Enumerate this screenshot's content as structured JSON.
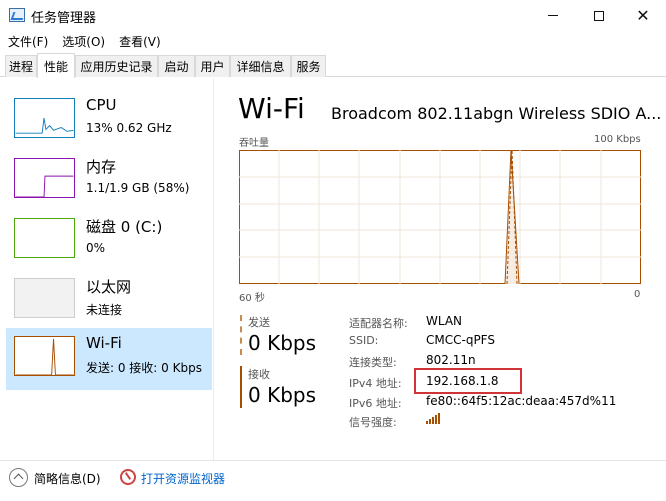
{
  "window": {
    "title": "任务管理器"
  },
  "menu": [
    "文件(F)",
    "选项(O)",
    "查看(V)"
  ],
  "tabs": [
    "进程",
    "性能",
    "应用历史记录",
    "启动",
    "用户",
    "详细信息",
    "服务"
  ],
  "active_tab": 1,
  "resources": [
    {
      "name": "CPU",
      "sub": "13%  0.62 GHz",
      "color": "#117dbb",
      "active": false
    },
    {
      "name": "内存",
      "sub": "1.1/1.9 GB (58%)",
      "color": "#8b12ae",
      "active": false
    },
    {
      "name": "磁盘 0 (C:)",
      "sub": "0%",
      "color": "#4da60c",
      "active": false
    },
    {
      "name": "以太网",
      "sub": "未连接",
      "color": "#999999",
      "active": false
    },
    {
      "name": "Wi-Fi",
      "sub": "发送: 0  接收: 0 Kbps",
      "color": "#a74f01",
      "active": true
    }
  ],
  "detail": {
    "title": "Wi-Fi",
    "adapter": "Broadcom 802.11abgn Wireless SDIO A...",
    "graph_left_label": "吞吐量",
    "graph_right_label": "100 Kbps",
    "graph_bottom_left": "60 秒",
    "graph_bottom_right": "0",
    "send_label": "发送",
    "send_value": "0 Kbps",
    "recv_label": "接收",
    "recv_value": "0 Kbps",
    "props": [
      {
        "name": "适配器名称:",
        "value": "WLAN"
      },
      {
        "name": "SSID:",
        "value": "CMCC-qPFS"
      },
      {
        "name": "连接类型:",
        "value": "802.11n"
      },
      {
        "name": "IPv4 地址:",
        "value": "192.168.1.8"
      },
      {
        "name": "IPv6 地址:",
        "value": "fe80::64f5:12ac:deaa:457d%11"
      },
      {
        "name": "信号强度:",
        "value": ""
      }
    ]
  },
  "footer": {
    "summary": "简略信息(D)",
    "monitor": "打开资源监视器"
  },
  "colors": {
    "accent": "#a74f01",
    "selected": "#cce8ff",
    "highlight": "#d13438",
    "link": "#0066cc"
  }
}
